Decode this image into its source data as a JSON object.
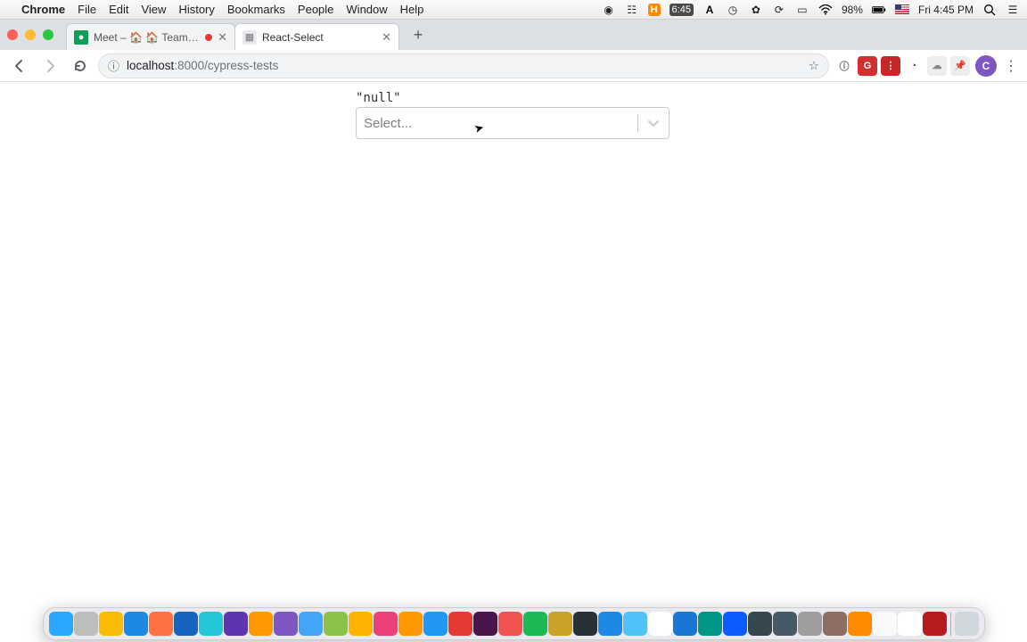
{
  "menubar": {
    "app": "Chrome",
    "items": [
      "File",
      "Edit",
      "View",
      "History",
      "Bookmarks",
      "People",
      "Window",
      "Help"
    ],
    "status": {
      "h_time": "6:45",
      "battery": "98%",
      "clock": "Fri 4:45 PM"
    }
  },
  "tabs": [
    {
      "title": "Meet – 🏠 🏠 Teamweek w",
      "active": false,
      "audio": true,
      "favicon_bg": "#0f9d58",
      "favicon_glyph": "●"
    },
    {
      "title": "React-Select",
      "active": true,
      "audio": false,
      "favicon_bg": "#e8eaed",
      "favicon_glyph": "▦"
    }
  ],
  "newtab_label": "+",
  "toolbar": {
    "url_host": "localhost",
    "url_port": ":8000",
    "url_path": "/cypress-tests",
    "extensions": [
      {
        "name": "info-extension",
        "bg": "#ffffff",
        "fg": "#5f6368",
        "glyph": "ⓘ"
      },
      {
        "name": "gns-extension",
        "bg": "#d32f2f",
        "fg": "#ffffff",
        "glyph": "G"
      },
      {
        "name": "lastpass-extension",
        "bg": "#c62828",
        "fg": "#ffffff",
        "glyph": "⋮"
      },
      {
        "name": "clock-extension",
        "bg": "#ffffff",
        "fg": "#444444",
        "glyph": "◔"
      },
      {
        "name": "ghost-extension",
        "bg": "#eeeeee",
        "fg": "#888888",
        "glyph": "☁"
      },
      {
        "name": "pin-extension",
        "bg": "#eeeeee",
        "fg": "#666666",
        "glyph": "📌"
      }
    ],
    "avatar_initial": "C"
  },
  "page": {
    "value_text": "\"null\"",
    "select_placeholder": "Select..."
  },
  "dock": [
    {
      "name": "finder",
      "bg": "#2aa7ff"
    },
    {
      "name": "launchpad",
      "bg": "#bdbdbd"
    },
    {
      "name": "chrome",
      "bg": "#fbbc05"
    },
    {
      "name": "safari",
      "bg": "#1e88e5"
    },
    {
      "name": "firefox",
      "bg": "#ff7043"
    },
    {
      "name": "vscode",
      "bg": "#1565c0"
    },
    {
      "name": "app-sky",
      "bg": "#26c6da"
    },
    {
      "name": "app-purple",
      "bg": "#5e35b1"
    },
    {
      "name": "app-orange",
      "bg": "#ff9800"
    },
    {
      "name": "app-deeppurple",
      "bg": "#7e57c2"
    },
    {
      "name": "mail",
      "bg": "#42a5f5"
    },
    {
      "name": "maps",
      "bg": "#8bc34a"
    },
    {
      "name": "app-amber",
      "bg": "#ffb300"
    },
    {
      "name": "itunes",
      "bg": "#ec407a"
    },
    {
      "name": "books",
      "bg": "#ff9800"
    },
    {
      "name": "appstore",
      "bg": "#2196f3"
    },
    {
      "name": "app-red",
      "bg": "#e53935"
    },
    {
      "name": "slack",
      "bg": "#4a154b"
    },
    {
      "name": "app-red2",
      "bg": "#ef5350"
    },
    {
      "name": "spotify",
      "bg": "#1db954"
    },
    {
      "name": "app-gold",
      "bg": "#c9a227"
    },
    {
      "name": "terminal",
      "bg": "#263238"
    },
    {
      "name": "app-blue2",
      "bg": "#1e88e5"
    },
    {
      "name": "app-sky2",
      "bg": "#4fc3f7"
    },
    {
      "name": "calendar",
      "bg": "#ffffff"
    },
    {
      "name": "app-blue3",
      "bg": "#1976d2"
    },
    {
      "name": "app-teal",
      "bg": "#009688"
    },
    {
      "name": "zoom",
      "bg": "#0b5cff"
    },
    {
      "name": "app-dark",
      "bg": "#37474f"
    },
    {
      "name": "screenshot",
      "bg": "#455a64"
    },
    {
      "name": "app-grey",
      "bg": "#9e9e9e"
    },
    {
      "name": "preview",
      "bg": "#8d6e63"
    },
    {
      "name": "app-h",
      "bg": "#ff8a00"
    },
    {
      "name": "notes",
      "bg": "#fafafa"
    },
    {
      "name": "notion",
      "bg": "#ffffff"
    },
    {
      "name": "app-red3",
      "bg": "#b71c1c"
    },
    {
      "name": "trash",
      "bg": "#cfd8dc"
    }
  ]
}
